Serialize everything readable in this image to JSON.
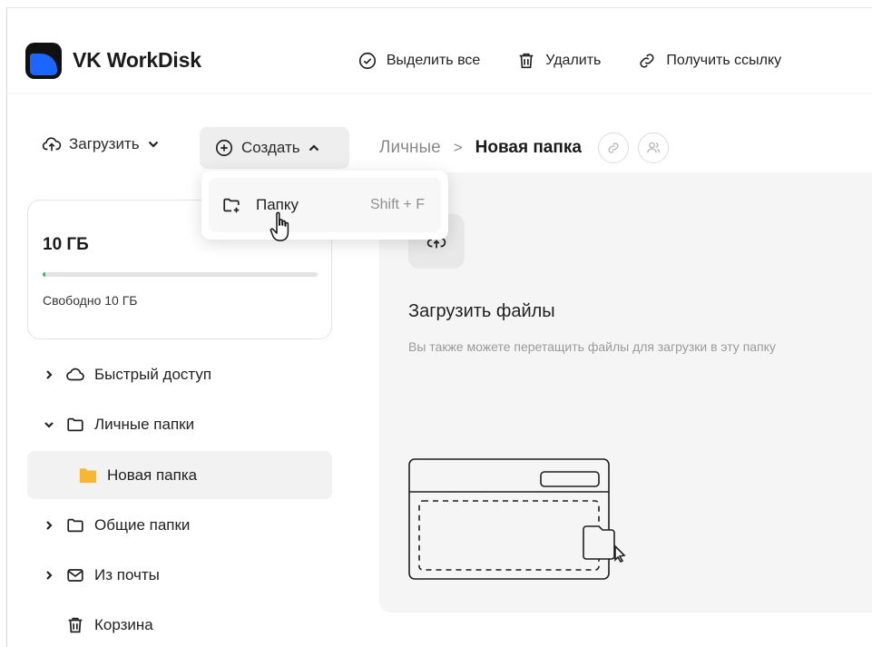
{
  "app": {
    "title": "VK WorkDisk"
  },
  "toolbar": {
    "select_all": "Выделить все",
    "delete": "Удалить",
    "get_link": "Получить ссылку"
  },
  "subbar": {
    "upload": "Загрузить",
    "create": "Создать"
  },
  "breadcrumb": {
    "parent": "Личные",
    "separator": ">",
    "current": "Новая папка"
  },
  "dropdown": {
    "item_label": "Папку",
    "item_shortcut": "Shift + F"
  },
  "storage": {
    "total": "10 ГБ",
    "free": "Свободно 10 ГБ",
    "used_fraction": 0.01
  },
  "sidebar": {
    "items": [
      {
        "label": "Быстрый доступ",
        "icon": "cloud-icon"
      },
      {
        "label": "Личные папки",
        "icon": "folder-icon"
      },
      {
        "label": "Новая папка",
        "icon": "folder-filled-icon"
      },
      {
        "label": "Общие папки",
        "icon": "folder-icon"
      },
      {
        "label": "Из почты",
        "icon": "mail-icon"
      },
      {
        "label": "Корзина",
        "icon": "trash-icon"
      }
    ]
  },
  "main": {
    "title": "Загрузить файлы",
    "subtitle": "Вы также можете перетащить файлы для загрузки в эту папку"
  },
  "colors": {
    "brand_blue": "#1a66ff",
    "folder_yellow": "#f7b733",
    "storage_green": "#2dbb5d"
  }
}
